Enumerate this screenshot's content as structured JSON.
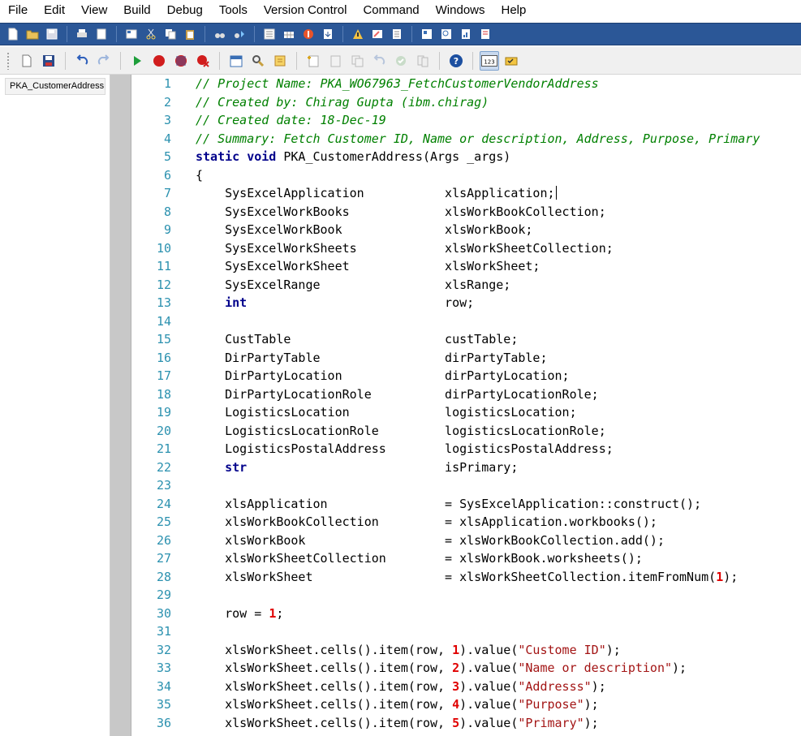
{
  "menu": [
    "File",
    "Edit",
    "View",
    "Build",
    "Debug",
    "Tools",
    "Version Control",
    "Command",
    "Windows",
    "Help"
  ],
  "toolbar1": {
    "icons": [
      "new-file-icon",
      "open-folder-icon",
      "save-icon",
      "print-icon",
      "print-preview-icon",
      "properties-icon",
      "cut-icon",
      "copy-icon",
      "paste-icon",
      "find-icon",
      "find-next-icon",
      "compile-icon",
      "table-icon",
      "breakpoint-icon",
      "import-icon",
      "warning-icon",
      "edit-icon",
      "list-icon",
      "application-object-icon",
      "query-icon",
      "report-icon",
      "menu-icon"
    ],
    "colors": {
      "background": "#2b5797"
    }
  },
  "toolbar2": {
    "icons": [
      "new-file-icon",
      "save-icon",
      "undo-icon",
      "redo-icon",
      "run-icon",
      "breakpoint-icon",
      "stop-icon",
      "remove-breakpoints-icon",
      "calendar-icon",
      "lookup-icon",
      "script-icon",
      "new-method-icon",
      "cut-method-icon",
      "copy-method-icon",
      "undo-method-icon",
      "ok-icon",
      "compare-icon",
      "help-icon",
      "line-numbers-icon",
      "code-check-icon"
    ],
    "active": "line-numbers-icon",
    "line_numbers_label": "123"
  },
  "tree": {
    "selected_item": "PKA_CustomerAddress"
  },
  "editor": {
    "colors": {
      "comment": "#008000",
      "keyword": "#00008b",
      "string": "#a31515",
      "number": "#e00000",
      "line_number": "#2b91af"
    },
    "lines": [
      {
        "n": "1",
        "segs": [
          {
            "c": "cm",
            "t": "// Project Name: PKA_WO67963_FetchCustomerVendorAddress"
          }
        ]
      },
      {
        "n": "2",
        "segs": [
          {
            "c": "cm",
            "t": "// Created by: Chirag Gupta (ibm.chirag)"
          }
        ]
      },
      {
        "n": "3",
        "segs": [
          {
            "c": "cm",
            "t": "// Created date: 18-Dec-19"
          }
        ]
      },
      {
        "n": "4",
        "segs": [
          {
            "c": "cm",
            "t": "// Summary: Fetch Customer ID, Name or description, Address, Purpose, Primary"
          }
        ]
      },
      {
        "n": "5",
        "segs": [
          {
            "c": "kw",
            "t": "static void"
          },
          {
            "c": "",
            "t": " PKA_CustomerAddress(Args _args)"
          }
        ]
      },
      {
        "n": "6",
        "segs": [
          {
            "c": "",
            "t": "{"
          }
        ]
      },
      {
        "n": "7",
        "segs": [
          {
            "c": "",
            "t": "    SysExcelApplication           xlsApplication;"
          }
        ],
        "caret": true
      },
      {
        "n": "8",
        "segs": [
          {
            "c": "",
            "t": "    SysExcelWorkBooks             xlsWorkBookCollection;"
          }
        ]
      },
      {
        "n": "9",
        "segs": [
          {
            "c": "",
            "t": "    SysExcelWorkBook              xlsWorkBook;"
          }
        ]
      },
      {
        "n": "10",
        "segs": [
          {
            "c": "",
            "t": "    SysExcelWorkSheets            xlsWorkSheetCollection;"
          }
        ]
      },
      {
        "n": "11",
        "segs": [
          {
            "c": "",
            "t": "    SysExcelWorkSheet             xlsWorkSheet;"
          }
        ]
      },
      {
        "n": "12",
        "segs": [
          {
            "c": "",
            "t": "    SysExcelRange                 xlsRange;"
          }
        ]
      },
      {
        "n": "13",
        "segs": [
          {
            "c": "",
            "t": "    "
          },
          {
            "c": "kw",
            "t": "int"
          },
          {
            "c": "",
            "t": "                           row;"
          }
        ]
      },
      {
        "n": "14",
        "segs": [
          {
            "c": "",
            "t": ""
          }
        ]
      },
      {
        "n": "15",
        "segs": [
          {
            "c": "",
            "t": "    CustTable                     custTable;"
          }
        ]
      },
      {
        "n": "16",
        "segs": [
          {
            "c": "",
            "t": "    DirPartyTable                 dirPartyTable;"
          }
        ]
      },
      {
        "n": "17",
        "segs": [
          {
            "c": "",
            "t": "    DirPartyLocation              dirPartyLocation;"
          }
        ]
      },
      {
        "n": "18",
        "segs": [
          {
            "c": "",
            "t": "    DirPartyLocationRole          dirPartyLocationRole;"
          }
        ]
      },
      {
        "n": "19",
        "segs": [
          {
            "c": "",
            "t": "    LogisticsLocation             logisticsLocation;"
          }
        ]
      },
      {
        "n": "20",
        "segs": [
          {
            "c": "",
            "t": "    LogisticsLocationRole         logisticsLocationRole;"
          }
        ]
      },
      {
        "n": "21",
        "segs": [
          {
            "c": "",
            "t": "    LogisticsPostalAddress        logisticsPostalAddress;"
          }
        ]
      },
      {
        "n": "22",
        "segs": [
          {
            "c": "",
            "t": "    "
          },
          {
            "c": "kw",
            "t": "str"
          },
          {
            "c": "",
            "t": "                           isPrimary;"
          }
        ]
      },
      {
        "n": "23",
        "segs": [
          {
            "c": "",
            "t": ""
          }
        ]
      },
      {
        "n": "24",
        "segs": [
          {
            "c": "",
            "t": "    xlsApplication                = SysExcelApplication::construct();"
          }
        ]
      },
      {
        "n": "25",
        "segs": [
          {
            "c": "",
            "t": "    xlsWorkBookCollection         = xlsApplication.workbooks();"
          }
        ]
      },
      {
        "n": "26",
        "segs": [
          {
            "c": "",
            "t": "    xlsWorkBook                   = xlsWorkBookCollection.add();"
          }
        ]
      },
      {
        "n": "27",
        "segs": [
          {
            "c": "",
            "t": "    xlsWorkSheetCollection        = xlsWorkBook.worksheets();"
          }
        ]
      },
      {
        "n": "28",
        "segs": [
          {
            "c": "",
            "t": "    xlsWorkSheet                  = xlsWorkSheetCollection.itemFromNum("
          },
          {
            "c": "nm",
            "t": "1"
          },
          {
            "c": "",
            "t": ");"
          }
        ]
      },
      {
        "n": "29",
        "segs": [
          {
            "c": "",
            "t": ""
          }
        ]
      },
      {
        "n": "30",
        "segs": [
          {
            "c": "",
            "t": "    row = "
          },
          {
            "c": "nm",
            "t": "1"
          },
          {
            "c": "",
            "t": ";"
          }
        ]
      },
      {
        "n": "31",
        "segs": [
          {
            "c": "",
            "t": ""
          }
        ]
      },
      {
        "n": "32",
        "segs": [
          {
            "c": "",
            "t": "    xlsWorkSheet.cells().item(row, "
          },
          {
            "c": "nm",
            "t": "1"
          },
          {
            "c": "",
            "t": ").value("
          },
          {
            "c": "st",
            "t": "\"Custome ID\""
          },
          {
            "c": "",
            "t": ");"
          }
        ]
      },
      {
        "n": "33",
        "segs": [
          {
            "c": "",
            "t": "    xlsWorkSheet.cells().item(row, "
          },
          {
            "c": "nm",
            "t": "2"
          },
          {
            "c": "",
            "t": ").value("
          },
          {
            "c": "st",
            "t": "\"Name or description\""
          },
          {
            "c": "",
            "t": ");"
          }
        ]
      },
      {
        "n": "34",
        "segs": [
          {
            "c": "",
            "t": "    xlsWorkSheet.cells().item(row, "
          },
          {
            "c": "nm",
            "t": "3"
          },
          {
            "c": "",
            "t": ").value("
          },
          {
            "c": "st",
            "t": "\"Addresss\""
          },
          {
            "c": "",
            "t": ");"
          }
        ]
      },
      {
        "n": "35",
        "segs": [
          {
            "c": "",
            "t": "    xlsWorkSheet.cells().item(row, "
          },
          {
            "c": "nm",
            "t": "4"
          },
          {
            "c": "",
            "t": ").value("
          },
          {
            "c": "st",
            "t": "\"Purpose\""
          },
          {
            "c": "",
            "t": ");"
          }
        ]
      },
      {
        "n": "36",
        "segs": [
          {
            "c": "",
            "t": "    xlsWorkSheet.cells().item(row, "
          },
          {
            "c": "nm",
            "t": "5"
          },
          {
            "c": "",
            "t": ").value("
          },
          {
            "c": "st",
            "t": "\"Primary\""
          },
          {
            "c": "",
            "t": ");"
          }
        ]
      }
    ]
  }
}
